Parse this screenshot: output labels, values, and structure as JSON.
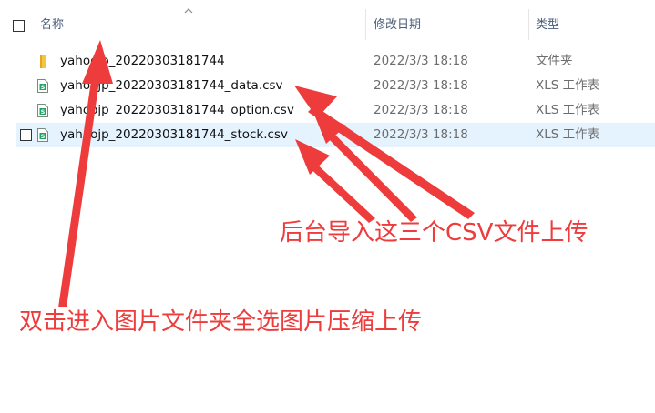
{
  "header": {
    "name_label": "名称",
    "date_label": "修改日期",
    "type_label": "类型"
  },
  "files": [
    {
      "name": "yahoojp_20220303181744",
      "date": "2022/3/3 18:18",
      "type": "文件夹",
      "icon": "folder-icon"
    },
    {
      "name": "yahoojp_20220303181744_data.csv",
      "date": "2022/3/3 18:18",
      "type": "XLS 工作表",
      "icon": "spreadsheet-icon"
    },
    {
      "name": "yahoojp_20220303181744_option.csv",
      "date": "2022/3/3 18:18",
      "type": "XLS 工作表",
      "icon": "spreadsheet-icon"
    },
    {
      "name": "yahoojp_20220303181744_stock.csv",
      "date": "2022/3/3 18:18",
      "type": "XLS 工作表",
      "icon": "spreadsheet-icon"
    }
  ],
  "annotations": {
    "csv_note": "后台导入这三个CSV文件上传",
    "folder_note": "双击进入图片文件夹全选图片压缩上传",
    "color": "#ee3b3b"
  },
  "colors": {
    "selected_row": "#e5f3ff",
    "header_text": "#4c607a",
    "folder": "#f4c542",
    "spreadsheet": "#21a366"
  }
}
